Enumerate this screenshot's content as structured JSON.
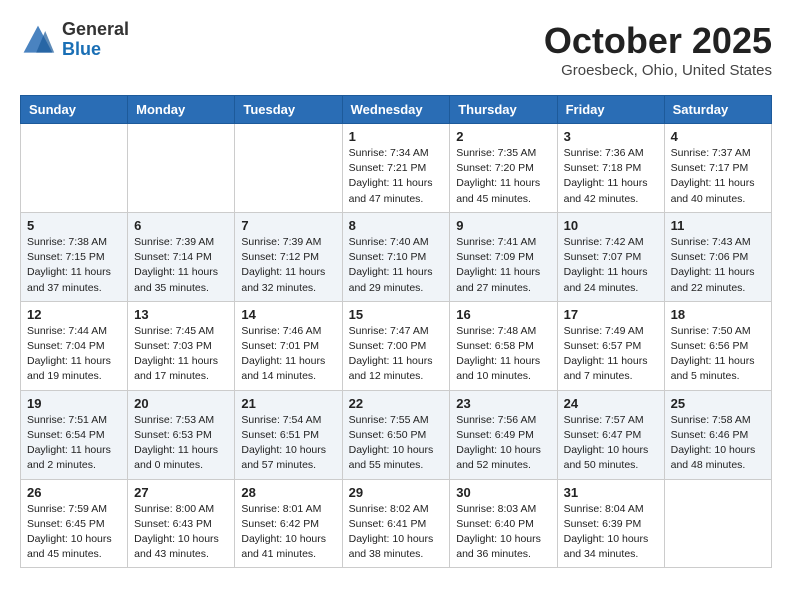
{
  "header": {
    "logo": {
      "line1": "General",
      "line2": "Blue"
    },
    "month_title": "October 2025",
    "location": "Groesbeck, Ohio, United States"
  },
  "days_of_week": [
    "Sunday",
    "Monday",
    "Tuesday",
    "Wednesday",
    "Thursday",
    "Friday",
    "Saturday"
  ],
  "weeks": [
    [
      {
        "num": "",
        "sunrise": "",
        "sunset": "",
        "daylight": ""
      },
      {
        "num": "",
        "sunrise": "",
        "sunset": "",
        "daylight": ""
      },
      {
        "num": "",
        "sunrise": "",
        "sunset": "",
        "daylight": ""
      },
      {
        "num": "1",
        "sunrise": "Sunrise: 7:34 AM",
        "sunset": "Sunset: 7:21 PM",
        "daylight": "Daylight: 11 hours and 47 minutes."
      },
      {
        "num": "2",
        "sunrise": "Sunrise: 7:35 AM",
        "sunset": "Sunset: 7:20 PM",
        "daylight": "Daylight: 11 hours and 45 minutes."
      },
      {
        "num": "3",
        "sunrise": "Sunrise: 7:36 AM",
        "sunset": "Sunset: 7:18 PM",
        "daylight": "Daylight: 11 hours and 42 minutes."
      },
      {
        "num": "4",
        "sunrise": "Sunrise: 7:37 AM",
        "sunset": "Sunset: 7:17 PM",
        "daylight": "Daylight: 11 hours and 40 minutes."
      }
    ],
    [
      {
        "num": "5",
        "sunrise": "Sunrise: 7:38 AM",
        "sunset": "Sunset: 7:15 PM",
        "daylight": "Daylight: 11 hours and 37 minutes."
      },
      {
        "num": "6",
        "sunrise": "Sunrise: 7:39 AM",
        "sunset": "Sunset: 7:14 PM",
        "daylight": "Daylight: 11 hours and 35 minutes."
      },
      {
        "num": "7",
        "sunrise": "Sunrise: 7:39 AM",
        "sunset": "Sunset: 7:12 PM",
        "daylight": "Daylight: 11 hours and 32 minutes."
      },
      {
        "num": "8",
        "sunrise": "Sunrise: 7:40 AM",
        "sunset": "Sunset: 7:10 PM",
        "daylight": "Daylight: 11 hours and 29 minutes."
      },
      {
        "num": "9",
        "sunrise": "Sunrise: 7:41 AM",
        "sunset": "Sunset: 7:09 PM",
        "daylight": "Daylight: 11 hours and 27 minutes."
      },
      {
        "num": "10",
        "sunrise": "Sunrise: 7:42 AM",
        "sunset": "Sunset: 7:07 PM",
        "daylight": "Daylight: 11 hours and 24 minutes."
      },
      {
        "num": "11",
        "sunrise": "Sunrise: 7:43 AM",
        "sunset": "Sunset: 7:06 PM",
        "daylight": "Daylight: 11 hours and 22 minutes."
      }
    ],
    [
      {
        "num": "12",
        "sunrise": "Sunrise: 7:44 AM",
        "sunset": "Sunset: 7:04 PM",
        "daylight": "Daylight: 11 hours and 19 minutes."
      },
      {
        "num": "13",
        "sunrise": "Sunrise: 7:45 AM",
        "sunset": "Sunset: 7:03 PM",
        "daylight": "Daylight: 11 hours and 17 minutes."
      },
      {
        "num": "14",
        "sunrise": "Sunrise: 7:46 AM",
        "sunset": "Sunset: 7:01 PM",
        "daylight": "Daylight: 11 hours and 14 minutes."
      },
      {
        "num": "15",
        "sunrise": "Sunrise: 7:47 AM",
        "sunset": "Sunset: 7:00 PM",
        "daylight": "Daylight: 11 hours and 12 minutes."
      },
      {
        "num": "16",
        "sunrise": "Sunrise: 7:48 AM",
        "sunset": "Sunset: 6:58 PM",
        "daylight": "Daylight: 11 hours and 10 minutes."
      },
      {
        "num": "17",
        "sunrise": "Sunrise: 7:49 AM",
        "sunset": "Sunset: 6:57 PM",
        "daylight": "Daylight: 11 hours and 7 minutes."
      },
      {
        "num": "18",
        "sunrise": "Sunrise: 7:50 AM",
        "sunset": "Sunset: 6:56 PM",
        "daylight": "Daylight: 11 hours and 5 minutes."
      }
    ],
    [
      {
        "num": "19",
        "sunrise": "Sunrise: 7:51 AM",
        "sunset": "Sunset: 6:54 PM",
        "daylight": "Daylight: 11 hours and 2 minutes."
      },
      {
        "num": "20",
        "sunrise": "Sunrise: 7:53 AM",
        "sunset": "Sunset: 6:53 PM",
        "daylight": "Daylight: 11 hours and 0 minutes."
      },
      {
        "num": "21",
        "sunrise": "Sunrise: 7:54 AM",
        "sunset": "Sunset: 6:51 PM",
        "daylight": "Daylight: 10 hours and 57 minutes."
      },
      {
        "num": "22",
        "sunrise": "Sunrise: 7:55 AM",
        "sunset": "Sunset: 6:50 PM",
        "daylight": "Daylight: 10 hours and 55 minutes."
      },
      {
        "num": "23",
        "sunrise": "Sunrise: 7:56 AM",
        "sunset": "Sunset: 6:49 PM",
        "daylight": "Daylight: 10 hours and 52 minutes."
      },
      {
        "num": "24",
        "sunrise": "Sunrise: 7:57 AM",
        "sunset": "Sunset: 6:47 PM",
        "daylight": "Daylight: 10 hours and 50 minutes."
      },
      {
        "num": "25",
        "sunrise": "Sunrise: 7:58 AM",
        "sunset": "Sunset: 6:46 PM",
        "daylight": "Daylight: 10 hours and 48 minutes."
      }
    ],
    [
      {
        "num": "26",
        "sunrise": "Sunrise: 7:59 AM",
        "sunset": "Sunset: 6:45 PM",
        "daylight": "Daylight: 10 hours and 45 minutes."
      },
      {
        "num": "27",
        "sunrise": "Sunrise: 8:00 AM",
        "sunset": "Sunset: 6:43 PM",
        "daylight": "Daylight: 10 hours and 43 minutes."
      },
      {
        "num": "28",
        "sunrise": "Sunrise: 8:01 AM",
        "sunset": "Sunset: 6:42 PM",
        "daylight": "Daylight: 10 hours and 41 minutes."
      },
      {
        "num": "29",
        "sunrise": "Sunrise: 8:02 AM",
        "sunset": "Sunset: 6:41 PM",
        "daylight": "Daylight: 10 hours and 38 minutes."
      },
      {
        "num": "30",
        "sunrise": "Sunrise: 8:03 AM",
        "sunset": "Sunset: 6:40 PM",
        "daylight": "Daylight: 10 hours and 36 minutes."
      },
      {
        "num": "31",
        "sunrise": "Sunrise: 8:04 AM",
        "sunset": "Sunset: 6:39 PM",
        "daylight": "Daylight: 10 hours and 34 minutes."
      },
      {
        "num": "",
        "sunrise": "",
        "sunset": "",
        "daylight": ""
      }
    ]
  ]
}
